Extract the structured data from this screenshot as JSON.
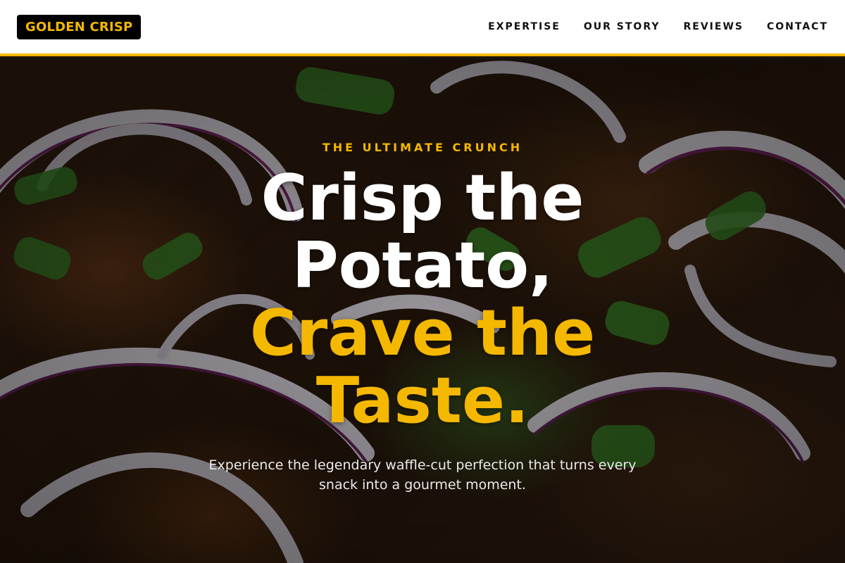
{
  "brand": {
    "logo_text": "GOLDEN CRISP"
  },
  "nav": {
    "items": [
      {
        "label": "EXPERTISE"
      },
      {
        "label": "OUR STORY"
      },
      {
        "label": "REVIEWS"
      },
      {
        "label": "CONTACT"
      }
    ]
  },
  "hero": {
    "eyebrow": "THE ULTIMATE CRUNCH",
    "headline_white": "Crisp the Potato,",
    "headline_accent": "Crave the Taste.",
    "subtext": "Experience the legendary waffle-cut perfection that turns every snack into a gourmet moment."
  },
  "colors": {
    "accent": "#f5b800",
    "header_bg": "#ffffff",
    "logo_bg": "#000000"
  }
}
